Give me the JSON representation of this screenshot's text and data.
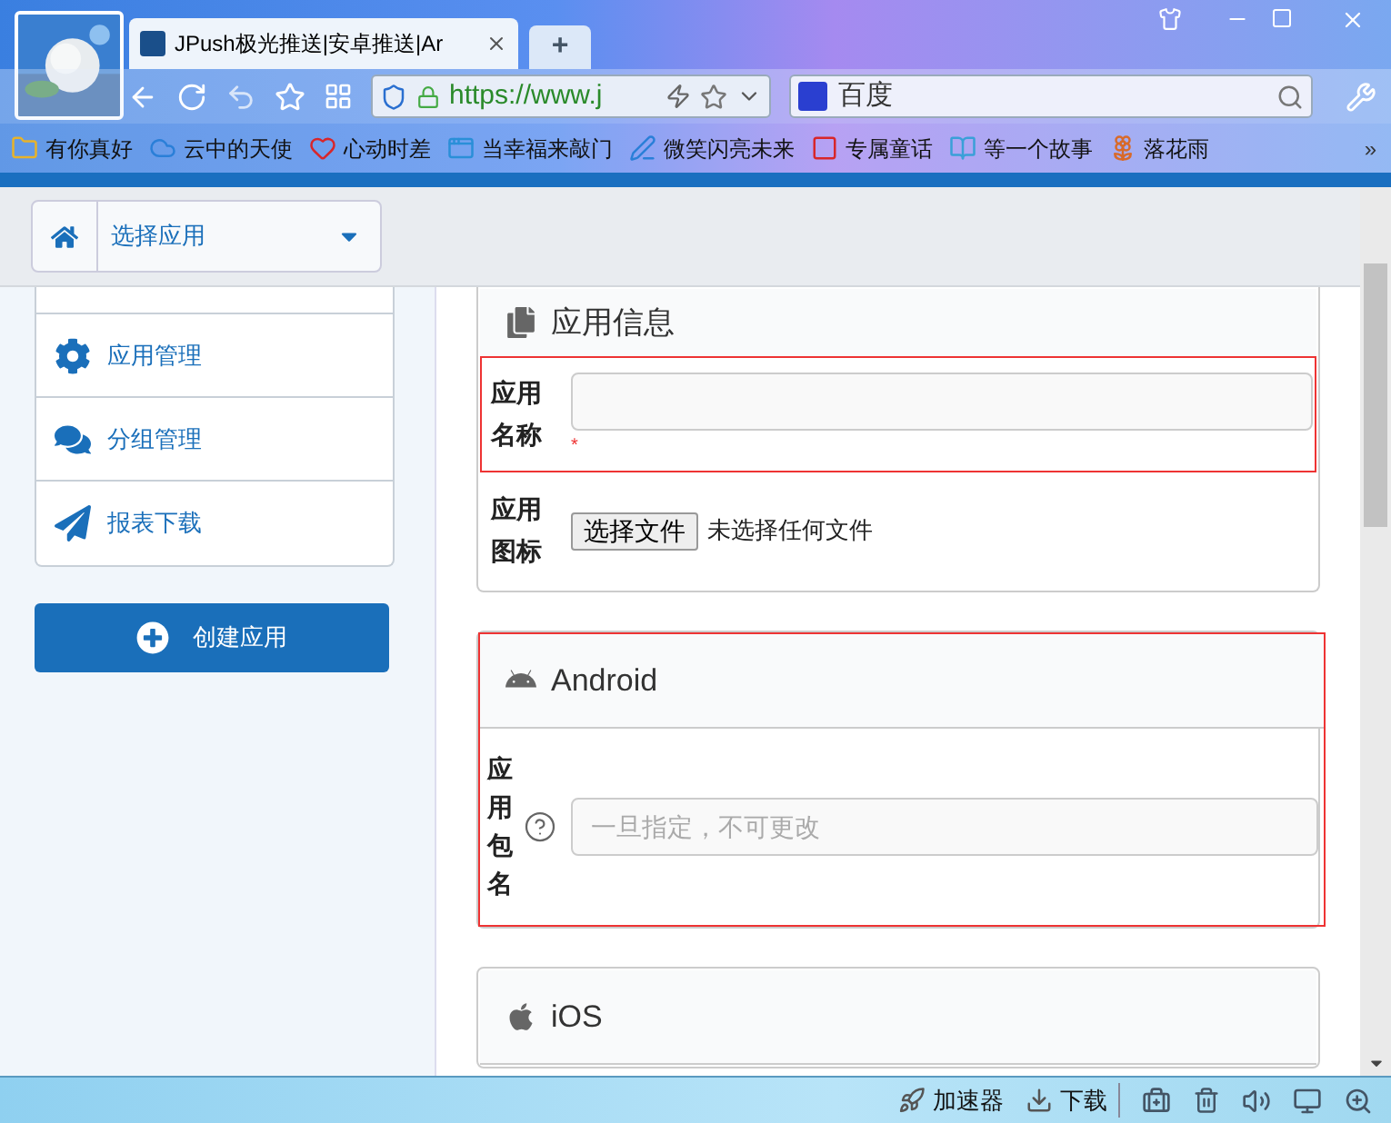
{
  "browser": {
    "tab_title": "JPush极光推送|安卓推送|Ar",
    "new_tab": "+",
    "address": "https://www.j",
    "search_engine": "百度",
    "bookmarks": [
      {
        "label": "有你真好",
        "kind": "folder"
      },
      {
        "label": "云中的天使",
        "kind": "cloud"
      },
      {
        "label": "心动时差",
        "kind": "heart"
      },
      {
        "label": "当幸福来敲门",
        "kind": "app"
      },
      {
        "label": "微笑闪亮未来",
        "kind": "pen"
      },
      {
        "label": "专属童话",
        "kind": "c"
      },
      {
        "label": "等一个故事",
        "kind": "book"
      },
      {
        "label": "落花雨",
        "kind": "flower"
      }
    ],
    "more": "»"
  },
  "page": {
    "app_selector": "选择应用",
    "sidebar": [
      {
        "label": "应用管理",
        "kind": "settings"
      },
      {
        "label": "分组管理",
        "kind": "chat"
      },
      {
        "label": "报表下载",
        "kind": "send"
      }
    ],
    "create_button": "创建应用",
    "cards": [
      {
        "title": "应用信息",
        "kind": "info",
        "fields": [
          {
            "label": [
              "应用",
              "名称"
            ],
            "kind": "text",
            "required_mark": "*",
            "highlighted": true
          },
          {
            "label": [
              "应用",
              "图标"
            ],
            "kind": "file",
            "button": "选择文件",
            "status": "未选择任何文件",
            "highlighted": false
          }
        ]
      },
      {
        "title": "Android",
        "kind": "android",
        "highlighted": true,
        "fields": [
          {
            "label": [
              "应",
              "用",
              "包",
              "名"
            ],
            "kind": "text",
            "help": true,
            "placeholder": "一旦指定，不可更改",
            "highlighted": false
          }
        ]
      },
      {
        "title": "iOS",
        "kind": "ios",
        "highlighted": false
      }
    ]
  },
  "status_bar": {
    "accelerator": "加速器",
    "download": "下载"
  }
}
